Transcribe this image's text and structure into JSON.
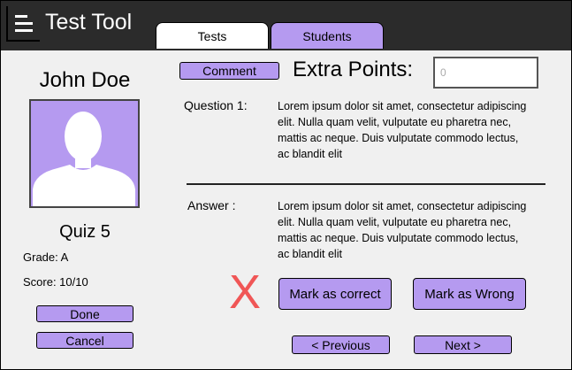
{
  "app": {
    "title": "Test Tool"
  },
  "tabs": [
    {
      "label": "Tests"
    },
    {
      "label": "Students"
    }
  ],
  "student": {
    "name": "John Doe",
    "quiz": "Quiz 5",
    "grade": "Grade: A",
    "score": "Score: 10/10"
  },
  "actions": {
    "done": "Done",
    "cancel": "Cancel"
  },
  "comment": {
    "label": "Comment"
  },
  "extra_points": {
    "label": "Extra Points:",
    "placeholder": "0"
  },
  "question": {
    "label": "Question 1:",
    "text": "Lorem ipsum dolor sit amet, consectetur adipiscing elit. Nulla quam velit, vulputate eu pharetra nec, mattis ac neque. Duis vulputate commodo lectus, ac blandit elit"
  },
  "answer": {
    "label": "Answer :",
    "text": "Lorem ipsum dolor sit amet, consectetur adipiscing elit. Nulla quam velit, vulputate eu pharetra nec, mattis ac neque. Duis vulputate commodo lectus, ac blandit elit"
  },
  "status_mark": "X",
  "marking": {
    "correct": "Mark as correct",
    "wrong": "Mark as Wrong"
  },
  "nav": {
    "previous": "< Previous",
    "next": "Next >"
  },
  "colors": {
    "accent": "#b59af0",
    "topbar": "#2b2b2b",
    "wrong_mark": "#f05656",
    "background": "#f0f0f0"
  },
  "icons": {
    "menu": "hamburger-menu-icon",
    "avatar": "person-silhouette-icon"
  }
}
